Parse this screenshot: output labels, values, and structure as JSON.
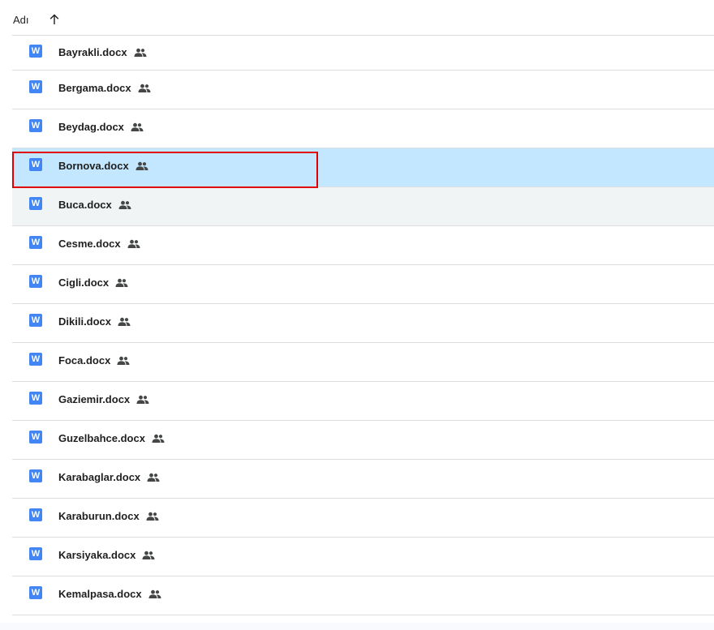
{
  "header": {
    "column_label": "Adı",
    "sort_icon": "arrow-up-icon"
  },
  "files": [
    {
      "name": "Bayrakli.docx",
      "shared": true
    },
    {
      "name": "Bergama.docx",
      "shared": true
    },
    {
      "name": "Beydag.docx",
      "shared": true
    },
    {
      "name": "Bornova.docx",
      "shared": true,
      "state": "selected"
    },
    {
      "name": "Buca.docx",
      "shared": true,
      "state": "hovered"
    },
    {
      "name": "Cesme.docx",
      "shared": true
    },
    {
      "name": "Cigli.docx",
      "shared": true
    },
    {
      "name": "Dikili.docx",
      "shared": true
    },
    {
      "name": "Foca.docx",
      "shared": true
    },
    {
      "name": "Gaziemir.docx",
      "shared": true
    },
    {
      "name": "Guzelbahce.docx",
      "shared": true
    },
    {
      "name": "Karabaglar.docx",
      "shared": true
    },
    {
      "name": "Karaburun.docx",
      "shared": true
    },
    {
      "name": "Karsiyaka.docx",
      "shared": true
    },
    {
      "name": "Kemalpasa.docx",
      "shared": true
    }
  ],
  "file_icon": {
    "name": "word-doc-icon",
    "glyph": "W",
    "color": "#4285f4"
  },
  "shared_icon": "people-icon",
  "colors": {
    "selected_row": "#c2e7ff",
    "hovered_row": "#f0f4f4",
    "highlight_box": "#e00000",
    "divider": "#dadce0"
  }
}
